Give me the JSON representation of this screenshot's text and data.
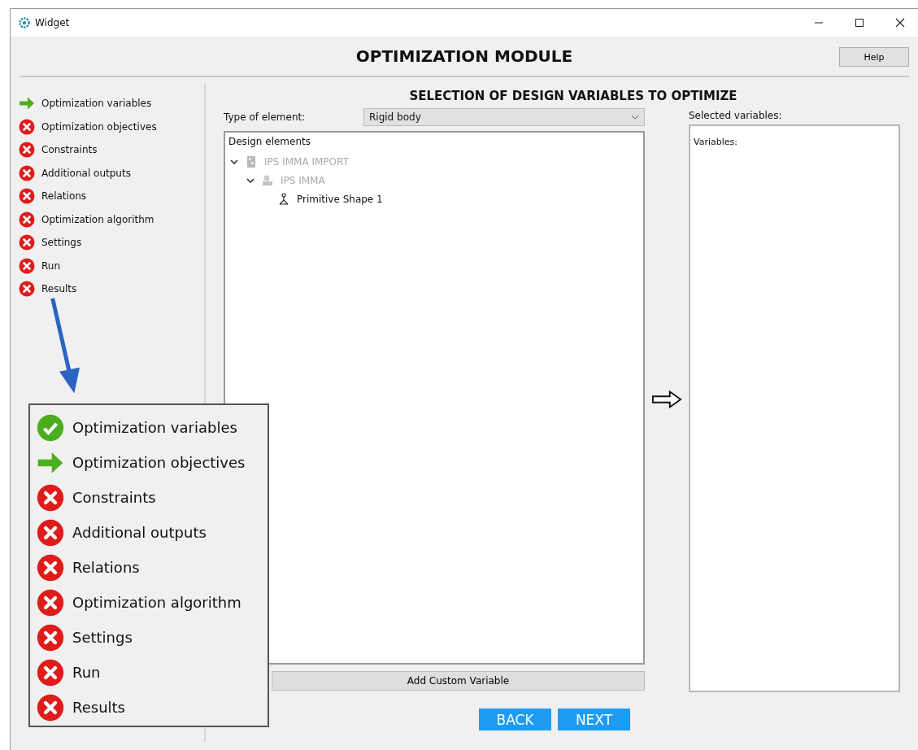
{
  "window": {
    "title": "Widget"
  },
  "header": {
    "title": "OPTIMIZATION MODULE",
    "help_button": "Help"
  },
  "sidebar": {
    "steps": [
      {
        "label": "Optimization variables",
        "kind": "current"
      },
      {
        "label": "Optimization objectives",
        "kind": "error"
      },
      {
        "label": "Constraints",
        "kind": "error"
      },
      {
        "label": "Additional outputs",
        "kind": "error"
      },
      {
        "label": "Relations",
        "kind": "error"
      },
      {
        "label": "Optimization algorithm",
        "kind": "error"
      },
      {
        "label": "Settings",
        "kind": "error"
      },
      {
        "label": "Run",
        "kind": "error"
      },
      {
        "label": "Results",
        "kind": "error"
      }
    ]
  },
  "main": {
    "heading": "SELECTION OF DESIGN VARIABLES TO OPTIMIZE",
    "type_label": "Type of element:",
    "type_value": "Rigid body",
    "tree": {
      "title": "Design elements",
      "items": [
        {
          "label": "IPS IMMA IMPORT",
          "kind": "assembly",
          "disabled": true,
          "expanded": true,
          "children": [
            {
              "label": "IPS IMMA",
              "kind": "group",
              "disabled": true,
              "expanded": true,
              "children": [
                {
                  "label": "Primitive Shape 1",
                  "kind": "shape",
                  "disabled": false
                }
              ]
            }
          ]
        }
      ]
    },
    "add_button": "Add Custom Variable",
    "selected_label": "Selected variables:",
    "selected_box_title": "Variables:",
    "back_button": "BACK",
    "next_button": "NEXT"
  },
  "zoom_inset": {
    "steps": [
      {
        "label": "Optimization variables",
        "kind": "done"
      },
      {
        "label": "Optimization objectives",
        "kind": "current"
      },
      {
        "label": "Constraints",
        "kind": "error"
      },
      {
        "label": "Additional outputs",
        "kind": "error"
      },
      {
        "label": "Relations",
        "kind": "error"
      },
      {
        "label": "Optimization algorithm",
        "kind": "error"
      },
      {
        "label": "Settings",
        "kind": "error"
      },
      {
        "label": "Run",
        "kind": "error"
      },
      {
        "label": "Results",
        "kind": "error"
      }
    ]
  }
}
